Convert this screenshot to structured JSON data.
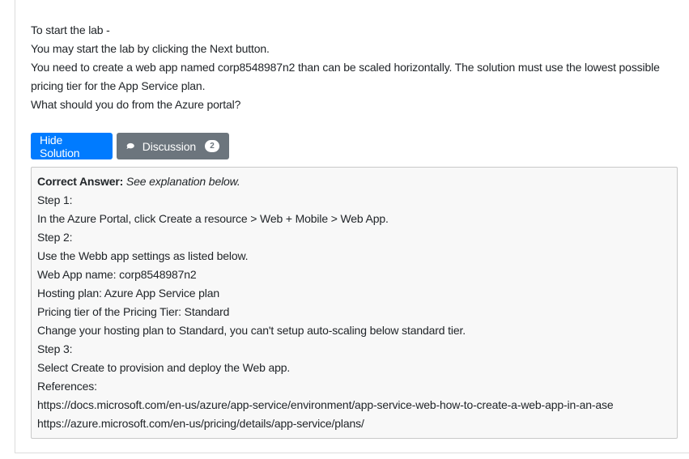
{
  "question": {
    "lines": [
      "To start the lab -",
      "You may start the lab by clicking the Next button.",
      "You need to create a web app named corp8548987n2 than can be scaled horizontally. The solution must use the lowest possible pricing tier for the App Service plan.",
      "What should you do from the Azure portal?"
    ]
  },
  "buttons": {
    "hide_solution": "Hide Solution",
    "discussion": "Discussion",
    "discussion_count": "2"
  },
  "answer": {
    "lead": "Correct Answer:",
    "explanation": "See explanation below.",
    "lines": [
      "Step 1:",
      "In the Azure Portal, click Create a resource > Web + Mobile > Web App.",
      "Step 2:",
      "Use the Webb app settings as listed below.",
      "Web App name: corp8548987n2",
      "Hosting plan: Azure App Service plan",
      "Pricing tier of the Pricing Tier: Standard",
      "Change your hosting plan to Standard, you can't setup auto-scaling below standard tier.",
      "Step 3:",
      "Select Create to provision and deploy the Web app.",
      "References:",
      "https://docs.microsoft.com/en-us/azure/app-service/environment/app-service-web-how-to-create-a-web-app-in-an-ase",
      "https://azure.microsoft.com/en-us/pricing/details/app-service/plans/"
    ]
  },
  "colors": {
    "primary": "#007bff",
    "secondary": "#6c757d"
  },
  "icons": {
    "discussion": "speech-bubble-icon"
  }
}
